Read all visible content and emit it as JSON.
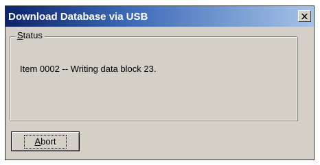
{
  "window": {
    "title": "Download Database via USB",
    "close_glyph": "×"
  },
  "status_group": {
    "legend_accel": "S",
    "legend_rest": "tatus",
    "message": "Item 0002 -- Writing data block 23."
  },
  "buttons": {
    "abort_accel": "A",
    "abort_rest": "bort"
  },
  "icons": {
    "close": "close-icon"
  },
  "colors": {
    "face": "#d4d0c8",
    "title_start": "#0c246a",
    "title_end": "#a6c3e8"
  }
}
